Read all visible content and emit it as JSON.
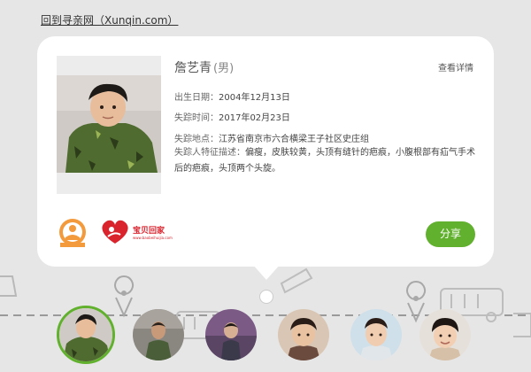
{
  "nav": {
    "back_label": "回到寻亲网（Xunqin.com）"
  },
  "person": {
    "name": "詹艺青",
    "gender": "(男)",
    "detail_link": "查看详情",
    "birth_label": "出生日期：",
    "birth_value": "2004年12月13日",
    "missing_time_label": "失踪时间：",
    "missing_time_value": "2017年02月23日",
    "missing_place_label": "失踪地点：",
    "missing_place_value": "江苏省南京市六合横梁王子社区史庄组",
    "features_label": "失踪人特征描述：",
    "features_value": "偏瘦，皮肤较黄，头顶有缝针的疤痕，小腹根部有疝气手术后的疤痕，头顶两个头旋。"
  },
  "logos": {
    "baobei_text": "宝贝回家",
    "baobei_url": "www.baobeihuijia.com"
  },
  "actions": {
    "share_label": "分享"
  },
  "thumbnails": [
    {
      "name": "thumb-1",
      "selected": true
    },
    {
      "name": "thumb-2",
      "selected": false
    },
    {
      "name": "thumb-3",
      "selected": false
    },
    {
      "name": "thumb-4",
      "selected": false
    },
    {
      "name": "thumb-5",
      "selected": false
    },
    {
      "name": "thumb-6",
      "selected": false
    }
  ],
  "colors": {
    "accent": "#62b12e",
    "brand_red": "#d9232d",
    "logo_orange": "#f39a3c"
  }
}
